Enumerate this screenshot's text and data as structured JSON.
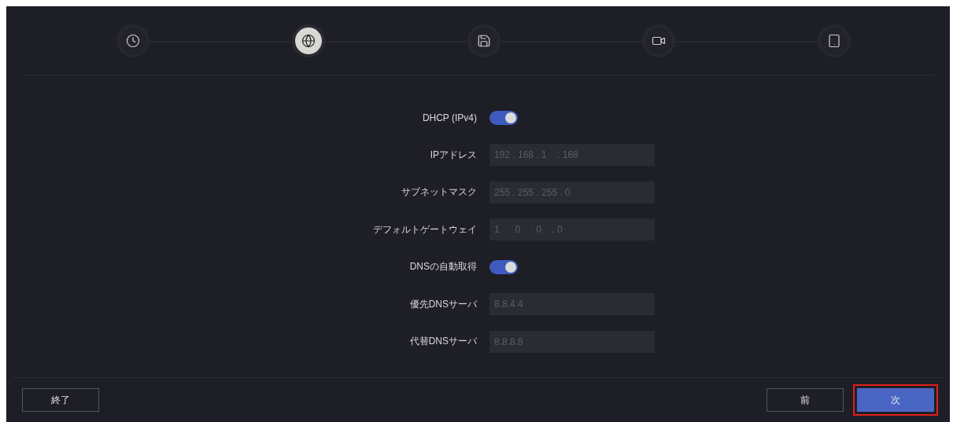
{
  "steps": [
    {
      "selected": false
    },
    {
      "selected": true
    },
    {
      "selected": false
    },
    {
      "selected": false
    },
    {
      "selected": false
    }
  ],
  "form": [
    {
      "kind": "toggle",
      "label": "DHCP (IPv4)",
      "on": true
    },
    {
      "kind": "field",
      "label": "IPアドレス",
      "value": "192 . 168 . 1    . 168",
      "disabled": true
    },
    {
      "kind": "field",
      "label": "サブネットマスク",
      "value": "255 . 255 . 255 . 0",
      "disabled": true
    },
    {
      "kind": "field",
      "label": "デフォルトゲートウェイ",
      "value": "1    . 0    . 0    . 0",
      "disabled": true
    },
    {
      "kind": "toggle",
      "label": "DNSの自動取得",
      "on": true
    },
    {
      "kind": "field",
      "label": "優先DNSサーバ",
      "value": "8.8.4.4",
      "disabled": true
    },
    {
      "kind": "field",
      "label": "代替DNSサーバ",
      "value": "8.8.8.8",
      "disabled": true
    }
  ],
  "footer": {
    "exit": {
      "label": "終了"
    },
    "prev": {
      "label": "前",
      "primary": false
    },
    "next": {
      "label": "次",
      "primary": true,
      "highlighted": true
    }
  }
}
